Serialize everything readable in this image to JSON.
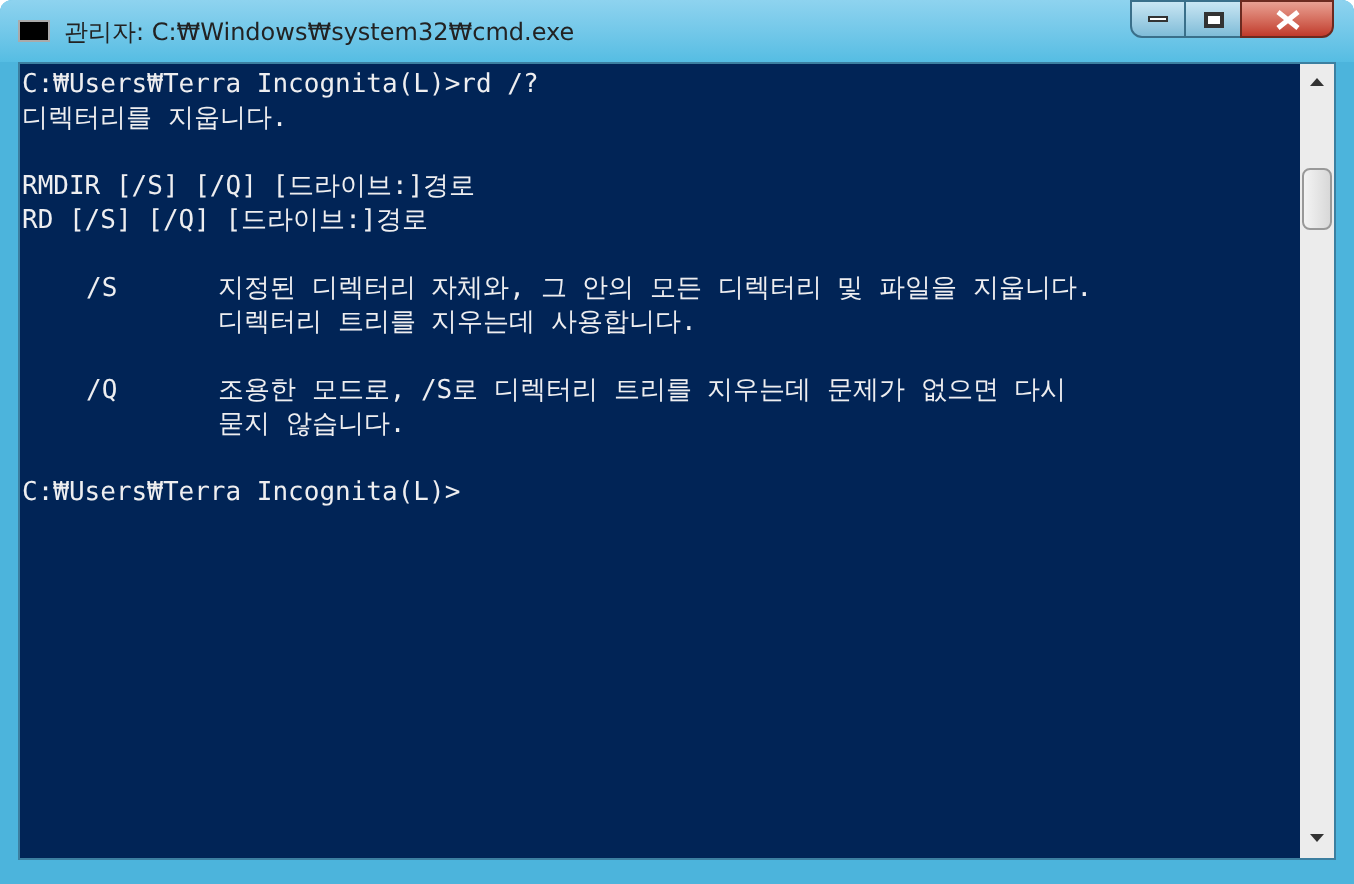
{
  "window": {
    "title": "관리자: C:₩Windows₩system32₩cmd.exe"
  },
  "console": [
    {
      "kind": "line",
      "text": "C:₩Users₩Terra Incognita(L)>rd /?"
    },
    {
      "kind": "line",
      "text": "디렉터리를 지웁니다."
    },
    {
      "kind": "blank"
    },
    {
      "kind": "line",
      "text": "RMDIR [/S] [/Q] [드라이브:]경로"
    },
    {
      "kind": "line",
      "text": "RD [/S] [/Q] [드라이브:]경로"
    },
    {
      "kind": "blank"
    },
    {
      "kind": "option",
      "switch": "/S",
      "lines": [
        "지정된 디렉터리 자체와, 그 안의 모든 디렉터리 및 파일을 지웁니다.",
        "디렉터리 트리를 지우는데 사용합니다."
      ]
    },
    {
      "kind": "blank"
    },
    {
      "kind": "option",
      "switch": "/Q",
      "lines": [
        "조용한 모드로, /S로 디렉터리 트리를 지우는데 문제가 없으면 다시",
        "묻지 않습니다."
      ]
    },
    {
      "kind": "blank"
    },
    {
      "kind": "line",
      "text": "C:₩Users₩Terra Incognita(L)>"
    }
  ]
}
